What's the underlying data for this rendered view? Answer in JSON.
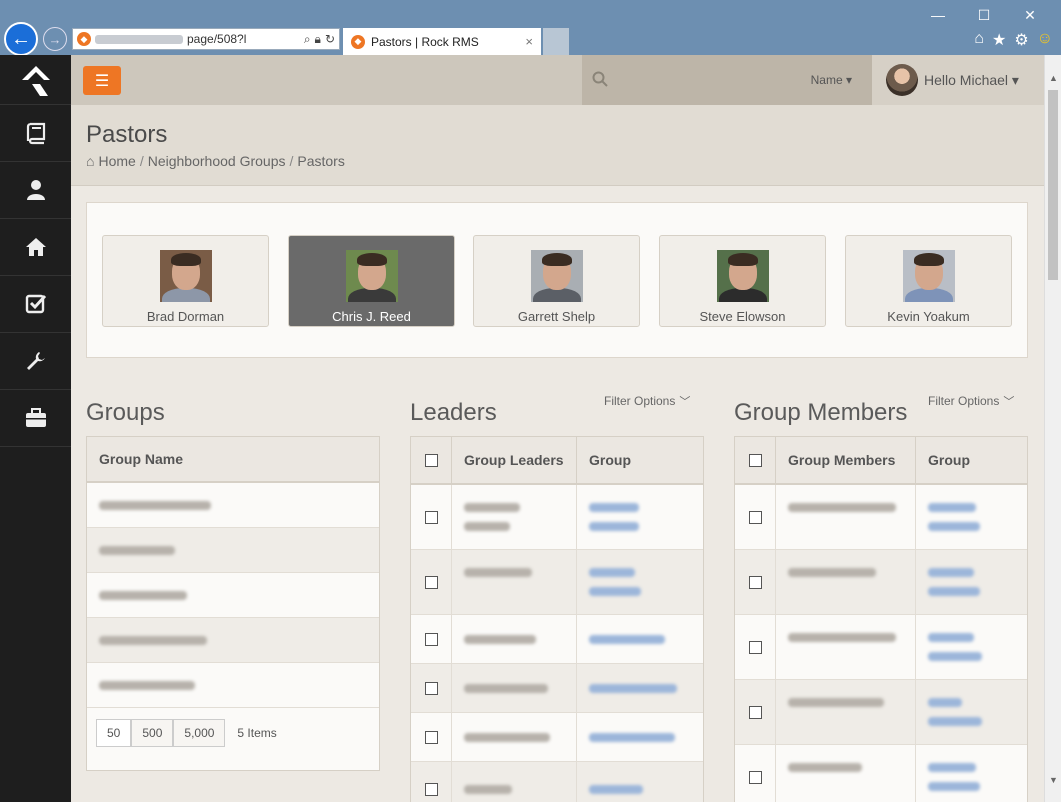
{
  "browser": {
    "url_visible": "page/508?l",
    "tab_title": "Pastors | Rock RMS",
    "tab_close": "×",
    "window_controls": [
      "—",
      "☐",
      "✕"
    ]
  },
  "topbar": {
    "menu_icon": "☰",
    "search_filter": "Name ▾",
    "user_greeting": "Hello Michael ▾"
  },
  "sidebar": {
    "items": [
      {
        "icon": "book-icon"
      },
      {
        "icon": "person-icon"
      },
      {
        "icon": "home-icon"
      },
      {
        "icon": "checkbox-icon"
      },
      {
        "icon": "wrench-icon"
      },
      {
        "icon": "briefcase-icon"
      }
    ]
  },
  "page": {
    "title": "Pastors",
    "breadcrumb": [
      "Home",
      "Neighborhood Groups",
      "Pastors"
    ],
    "breadcrumb_sep": "/"
  },
  "pastors": [
    {
      "name": "Brad Dorman",
      "shirt": "#8d97a8",
      "bg": "#7a5c46"
    },
    {
      "name": "Chris J. Reed",
      "shirt": "#3a3a3a",
      "bg": "#6e8a4e"
    },
    {
      "name": "Garrett Shelp",
      "shirt": "#5b5f66",
      "bg": "#a9aeb3"
    },
    {
      "name": "Steve Elowson",
      "shirt": "#2c2c2c",
      "bg": "#55704a"
    },
    {
      "name": "Kevin Yoakum",
      "shirt": "#7e93b8",
      "bg": "#b9bec6"
    }
  ],
  "groups": {
    "title": "Groups",
    "column": "Group Name",
    "page_sizes": [
      "50",
      "500",
      "5,000"
    ],
    "item_count": "5 Items"
  },
  "leaders": {
    "title": "Leaders",
    "filter": "Filter Options",
    "columns": [
      "Group Leaders",
      "Group"
    ]
  },
  "members": {
    "title": "Group Members",
    "filter": "Filter Options",
    "columns": [
      "Group Members",
      "Group"
    ]
  },
  "colors": {
    "accent": "#ee7624",
    "sidebar": "#1e1e1e"
  }
}
